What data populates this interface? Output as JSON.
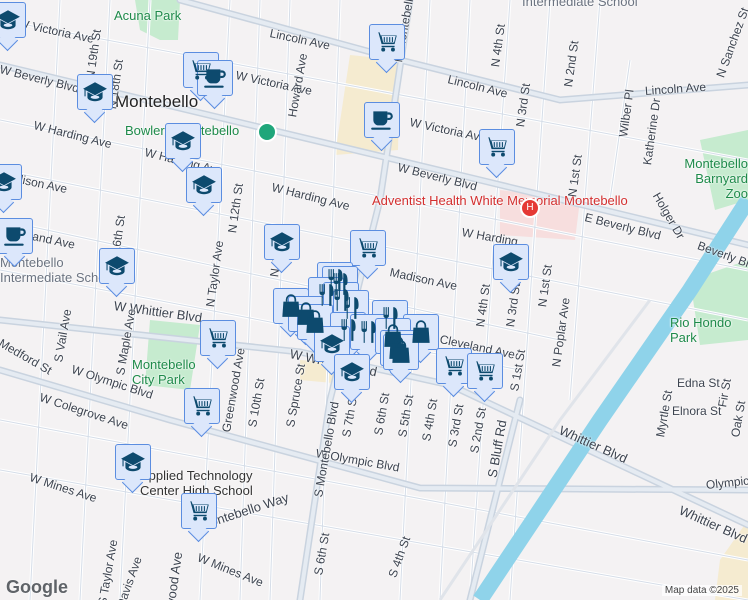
{
  "map": {
    "labels": {
      "city": "Montebello",
      "acuna_park": "Acuna Park",
      "bowlero": "Bowlero Montebello",
      "adventist": "Adventist Health White Memorial Montebello",
      "barnyard": "Montebello Barnyard Zoo",
      "rio_hondo": "Rio Hondo Park",
      "city_park": "Montebello City Park",
      "montebello_intermediate": "Montebello Intermediate School",
      "intermediate": "Intermediate School",
      "applied_tech": "Applied Technology Center High School",
      "lincoln1": "Lincoln Ave",
      "lincoln2": "Lincoln Ave",
      "lincoln3": "Lincoln Ave",
      "beverly1": "W Beverly Blvd",
      "beverly2": "W Beverly Blvd",
      "beverly3": "E Beverly Blvd",
      "beverly4": "Beverly Bl",
      "victoria1": "W Victoria Ave",
      "victoria2": "W Victoria Ave",
      "victoria3": "W Victoria Ave",
      "harding1": "W Harding Ave",
      "harding2": "W Harding Ave",
      "harding3": "W Harding Ave",
      "harding4": "W Harding",
      "madison1": "Madison Ave",
      "madison2": "Madison Ave",
      "cleveland1": "Cleveland Ave",
      "cleveland2": "Cleveland Ave",
      "whittier1": "W Whittier Blvd",
      "whittier2": "W Whittier Blvd",
      "whittier3": "Whittier Blvd",
      "whittier4": "Whittier Blvd",
      "olympic1": "W Olympic Blvd",
      "olympic2": "W Olympic Blvd",
      "olympic3": "Olympic",
      "colegrove": "W Colegrove Ave",
      "mines1": "W Mines Ave",
      "mines2": "W Mines Ave",
      "montebello_way": "Montebello Way",
      "n_montebello": "N Montebello",
      "s_montebello": "S Montebello Blvd",
      "howard": "Howard Ave",
      "n19": "N 19th St",
      "n18": "N 18th St",
      "n16": "N 16th St",
      "n12": "N 12th St",
      "n10": "N 10th St",
      "taylor": "N Taylor Ave",
      "n4": "N 4th St",
      "n3": "N 3rd St",
      "n2": "N 2nd St",
      "n1": "N 1st St",
      "n3b": "N 3rd St",
      "n1b": "N 1st St",
      "n4b": "N 4th St",
      "poplar": "N Poplar Ave",
      "wilber": "Wilber Pl",
      "katherine": "Katherine Dr",
      "holger": "Holger Dr",
      "sanchez": "N Sanchez St",
      "vail": "S Vail Ave",
      "maple": "S Maple Ave",
      "medford": "Medford St",
      "greenwood": "Greenwood Ave",
      "s10": "S 10th St",
      "spruce": "S Spruce St",
      "s7": "S 7th St",
      "s6": "S 6th St",
      "s5": "S 5th St",
      "s4": "S 4th St",
      "s3": "S 3rd St",
      "s2": "S 2nd St",
      "s1": "S 1st St",
      "s6b": "S 6th St",
      "s4b": "S 4th St",
      "bluff": "S Bluff Rd",
      "myrtle": "Myrtle St",
      "edna": "Edna St",
      "elnora": "Elnora St",
      "fir": "Fir St",
      "oak": "Oak St",
      "taylor_s": "S Taylor Ave",
      "davis": "Davis Ave",
      "wood": "wood Ave",
      "hospital": "H"
    },
    "attribution": "Map data ©2025",
    "logo": "Google",
    "colors": {
      "marker_fill": "#dce7fb",
      "marker_border": "#5b8de0",
      "icon": "#0d4a6e",
      "river": "#8fd3ea",
      "park": "#c6ebcf"
    }
  }
}
